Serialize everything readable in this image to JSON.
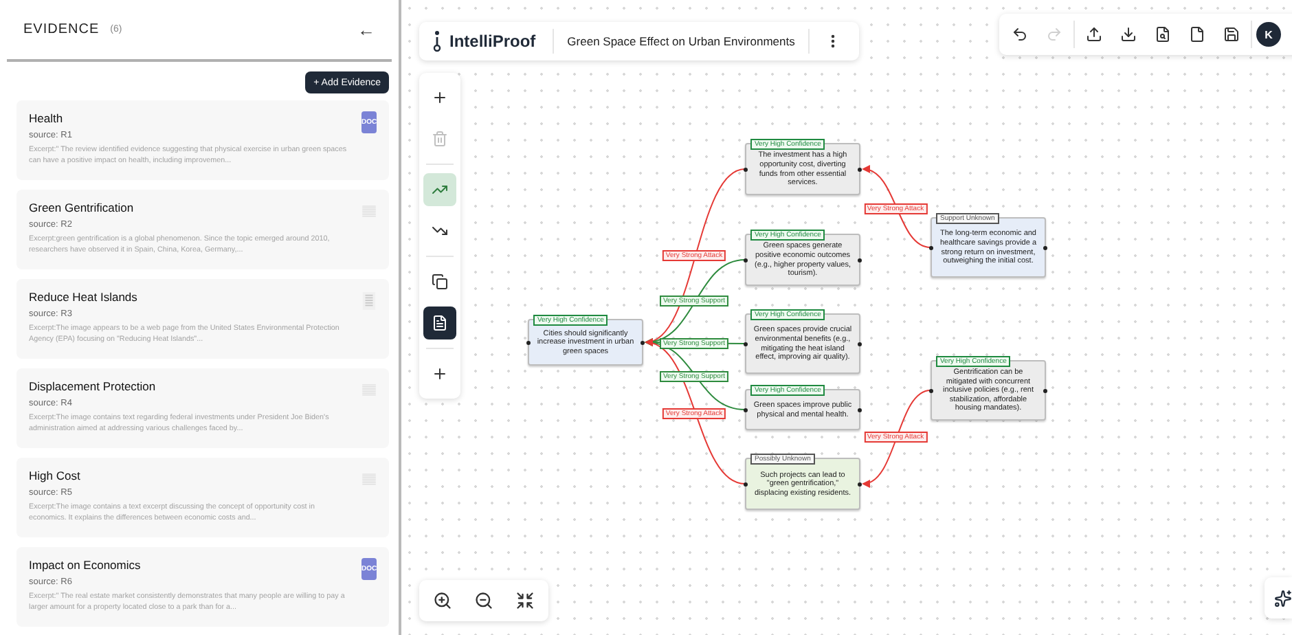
{
  "evidence_panel": {
    "title": "EVIDENCE",
    "count": "(6)",
    "back": "←",
    "add_button": "+ Add Evidence",
    "items": [
      {
        "title": "Health",
        "source": "source: R1",
        "excerpt": "Excerpt:\" The review identified evidence suggesting that physical exercise in urban green spaces can have a positive impact on health, including improvemen...",
        "thumb": {
          "kind": "doc",
          "label": "DOC"
        }
      },
      {
        "title": "Green Gentrification",
        "source": "source: R2",
        "excerpt": "Excerpt:green gentrification is a global phenomenon. Since the topic emerged around 2010, researchers have observed it in Spain, China, Korea, Germany,...",
        "thumb": {
          "kind": "page"
        }
      },
      {
        "title": "Reduce Heat Islands",
        "source": "source: R3",
        "excerpt": "Excerpt:The image appears to be a web page from the United States Environmental Protection Agency (EPA) focusing on \"Reducing Heat Islands\"...",
        "thumb": {
          "kind": "narrow"
        }
      },
      {
        "title": "Displacement Protection",
        "source": "source: R4",
        "excerpt": "Excerpt:The image contains text regarding federal investments under President Joe Biden's administration aimed at addressing various challenges faced by...",
        "thumb": {
          "kind": "page"
        }
      },
      {
        "title": "High Cost",
        "source": "source: R5",
        "excerpt": "Excerpt:The image contains a text excerpt discussing the concept of opportunity cost in economics. It explains the differences between economic costs and...",
        "thumb": {
          "kind": "page"
        }
      },
      {
        "title": "Impact on Economics",
        "source": "source: R6",
        "excerpt": "Excerpt:\" The real estate market consistently demonstrates that many people are willing to pay a larger amount for a property located close to a park than for a...",
        "thumb": {
          "kind": "doc",
          "label": "DOC"
        }
      }
    ]
  },
  "top_bar": {
    "app_name": "IntelliProof",
    "document_title": "Green Space Effect on Urban Environments"
  },
  "actions": [
    {
      "disabled": false
    },
    {
      "disabled": true
    },
    {
      "disabled": false
    },
    {
      "disabled": false
    },
    {
      "disabled": false
    },
    {
      "disabled": false
    },
    {
      "disabled": false
    }
  ],
  "user": {
    "initial": "K"
  },
  "tools": [
    {
      "selected": false,
      "disabled": false,
      "pressed": false
    },
    {
      "selected": false,
      "disabled": true,
      "pressed": false
    },
    {
      "selected": true,
      "disabled": false,
      "pressed": false
    },
    {
      "selected": false,
      "disabled": false,
      "pressed": false
    },
    {
      "selected": false,
      "disabled": false,
      "pressed": false
    },
    {
      "selected": false,
      "disabled": false,
      "pressed": true
    },
    {
      "selected": false,
      "disabled": false,
      "pressed": false
    }
  ],
  "graph": {
    "nodes": [
      {
        "tag": "Very High Confidence",
        "text": "Cities should significantly increase investment in urban green spaces",
        "color": "#e6edf8",
        "kind": "confident"
      },
      {
        "tag": "Very High Confidence",
        "text": "The investment has a high opportunity cost, diverting funds from other essential services.",
        "color": "#ececec",
        "kind": "confident"
      },
      {
        "tag": "Very High Confidence",
        "text": "Green spaces generate positive economic outcomes (e.g., higher property values, tourism).",
        "color": "#ececec",
        "kind": "confident"
      },
      {
        "tag": "Very High Confidence",
        "text": "Green spaces provide crucial environmental benefits (e.g., mitigating the heat island effect, improving air quality).",
        "color": "#ececec",
        "kind": "confident"
      },
      {
        "tag": "Very High Confidence",
        "text": "Green spaces improve public physical and mental health.",
        "color": "#ececec",
        "kind": "confident"
      },
      {
        "tag": "Possibly Unknown",
        "text": "Such projects can lead to \"green gentrification,\" displacing existing residents.",
        "color": "#e9f3e0",
        "kind": "unknown"
      },
      {
        "tag": "Support Unknown",
        "text": "The long-term economic and healthcare savings provide a strong return on investment, outweighing the initial cost.",
        "color": "#e6edf8",
        "kind": "unknown"
      },
      {
        "tag": "Very High Confidence",
        "text": "Gentrification can be mitigated with concurrent inclusive policies (e.g., rent stabilization, affordable housing mandates).",
        "color": "#ececec",
        "kind": "confident"
      }
    ],
    "edges": [
      {
        "kind": "attack",
        "label": "Very Strong Attack"
      },
      {
        "kind": "support",
        "label": "Very Strong Support"
      },
      {
        "kind": "support",
        "label": "Very Strong Support"
      },
      {
        "kind": "support",
        "label": "Very Strong Support"
      },
      {
        "kind": "attack",
        "label": "Very Strong Attack"
      },
      {
        "kind": "attack",
        "label": "Very Strong Attack"
      },
      {
        "kind": "attack",
        "label": "Very Strong Attack"
      }
    ]
  }
}
